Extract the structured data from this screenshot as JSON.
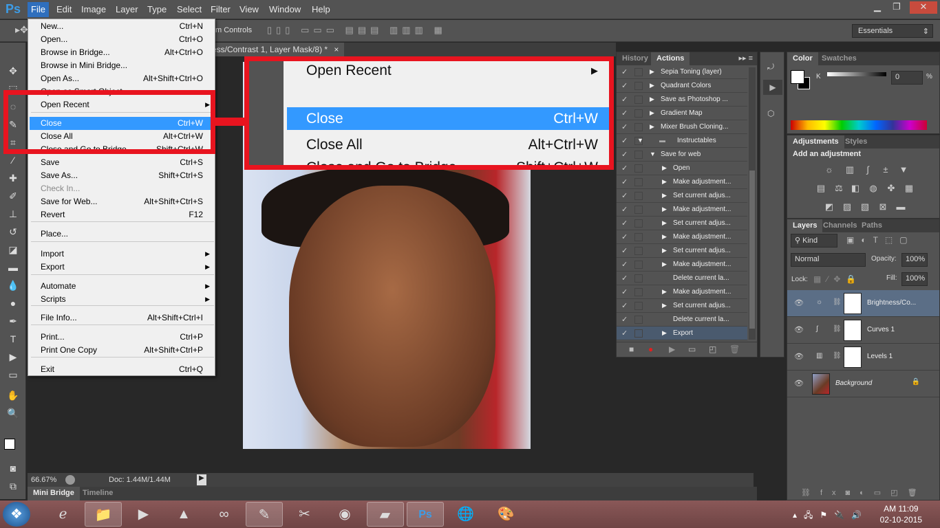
{
  "app": {
    "logo": "Ps"
  },
  "menubar": {
    "items": [
      "File",
      "Edit",
      "Image",
      "Layer",
      "Type",
      "Select",
      "Filter",
      "View",
      "Window",
      "Help"
    ]
  },
  "window_controls": {
    "minimize": "▁",
    "restore": "❐",
    "close": "✕"
  },
  "options": {
    "transform_controls_label": "m Controls",
    "workspace": "Essentials"
  },
  "document_tab": {
    "title": "ess/Contrast 1, Layer Mask/8) *",
    "close": "×"
  },
  "file_menu": {
    "items": [
      {
        "label": "New...",
        "shortcut": "Ctrl+N"
      },
      {
        "label": "Open...",
        "shortcut": "Ctrl+O"
      },
      {
        "label": "Browse in Bridge...",
        "shortcut": "Alt+Ctrl+O"
      },
      {
        "label": "Browse in Mini Bridge...",
        "shortcut": ""
      },
      {
        "label": "Open As...",
        "shortcut": "Alt+Shift+Ctrl+O"
      },
      {
        "label": "Open as Smart Object...",
        "shortcut": ""
      },
      {
        "label": "Open Recent",
        "shortcut": "",
        "submenu": true
      },
      {
        "label": "Close",
        "shortcut": "Ctrl+W",
        "highlighted": true
      },
      {
        "label": "Close All",
        "shortcut": "Alt+Ctrl+W"
      },
      {
        "label": "Close and Go to Bridge...",
        "shortcut": "Shift+Ctrl+W"
      },
      {
        "label": "Save",
        "shortcut": "Ctrl+S"
      },
      {
        "label": "Save As...",
        "shortcut": "Shift+Ctrl+S"
      },
      {
        "label": "Check In...",
        "shortcut": "",
        "disabled": true
      },
      {
        "label": "Save for Web...",
        "shortcut": "Alt+Shift+Ctrl+S"
      },
      {
        "label": "Revert",
        "shortcut": "F12"
      },
      {
        "label": "Place...",
        "shortcut": ""
      },
      {
        "label": "Import",
        "shortcut": "",
        "submenu": true
      },
      {
        "label": "Export",
        "shortcut": "",
        "submenu": true
      },
      {
        "label": "Automate",
        "shortcut": "",
        "submenu": true
      },
      {
        "label": "Scripts",
        "shortcut": "",
        "submenu": true
      },
      {
        "label": "File Info...",
        "shortcut": "Alt+Shift+Ctrl+I"
      },
      {
        "label": "Print...",
        "shortcut": "Ctrl+P"
      },
      {
        "label": "Print One Copy",
        "shortcut": "Alt+Shift+Ctrl+P"
      },
      {
        "label": "Exit",
        "shortcut": "Ctrl+Q"
      }
    ]
  },
  "callout": {
    "items": [
      {
        "label": "Open Recent",
        "shortcut": "▶"
      },
      {
        "label": "Close",
        "shortcut": "Ctrl+W",
        "highlighted": true
      },
      {
        "label": "Close All",
        "shortcut": "Alt+Ctrl+W"
      },
      {
        "label": "Close and Go to Bridge...",
        "shortcut": "Shift+Ctrl+W"
      }
    ]
  },
  "actions_panel": {
    "tabs": [
      "History",
      "Actions"
    ],
    "active_tab": "Actions",
    "rows": [
      {
        "label": "Sepia Toning (layer)",
        "level": 1,
        "expanded": false
      },
      {
        "label": "Quadrant Colors",
        "level": 1,
        "expanded": false
      },
      {
        "label": "Save as Photoshop ...",
        "level": 1,
        "expanded": false
      },
      {
        "label": "Gradient Map",
        "level": 1,
        "expanded": false
      },
      {
        "label": "Mixer Brush Cloning...",
        "level": 1,
        "expanded": false
      },
      {
        "label": "Instructables",
        "level": 0,
        "expanded": true,
        "folder": true
      },
      {
        "label": "Save for web",
        "level": 1,
        "expanded": true
      },
      {
        "label": "Open",
        "level": 2,
        "expanded": false
      },
      {
        "label": "Make adjustment...",
        "level": 2,
        "expanded": false
      },
      {
        "label": "Set current adjus...",
        "level": 2,
        "expanded": false
      },
      {
        "label": "Make adjustment...",
        "level": 2,
        "expanded": false
      },
      {
        "label": "Set current adjus...",
        "level": 2,
        "expanded": false
      },
      {
        "label": "Make adjustment...",
        "level": 2,
        "expanded": false
      },
      {
        "label": "Set current adjus...",
        "level": 2,
        "expanded": false
      },
      {
        "label": "Make adjustment...",
        "level": 2,
        "expanded": false
      },
      {
        "label": "Delete current la...",
        "level": 2,
        "noarrow": true
      },
      {
        "label": "Make adjustment...",
        "level": 2,
        "expanded": false
      },
      {
        "label": "Set current adjus...",
        "level": 2,
        "expanded": false
      },
      {
        "label": "Delete current la...",
        "level": 2,
        "noarrow": true
      },
      {
        "label": "Export",
        "level": 2,
        "expanded": false,
        "selected": true
      }
    ]
  },
  "color_panel": {
    "tabs": [
      "Color",
      "Swatches"
    ],
    "channel": "K",
    "value": "0",
    "unit": "%"
  },
  "adjustments_panel": {
    "tabs": [
      "Adjustments",
      "Styles"
    ],
    "heading": "Add an adjustment",
    "icons": [
      [
        "brightness-contrast",
        "levels",
        "curves",
        "exposure",
        "vibrance"
      ],
      [
        "hue-saturation",
        "color-balance",
        "black-white",
        "photo-filter",
        "channel-mixer",
        "color-lookup"
      ],
      [
        "invert",
        "posterize",
        "threshold",
        "selective-color",
        "gradient-map"
      ]
    ],
    "glyphs": [
      [
        "☼",
        "▥",
        "∫",
        "±",
        "▼"
      ],
      [
        "▤",
        "⚖",
        "◧",
        "◍",
        "✤",
        "▦"
      ],
      [
        "◩",
        "▨",
        "▧",
        "⊠",
        "▬"
      ]
    ]
  },
  "layers_panel": {
    "tabs": [
      "Layers",
      "Channels",
      "Paths"
    ],
    "filter": "Kind",
    "blend_mode": "Normal",
    "opacity_label": "Opacity:",
    "opacity": "100%",
    "lock_label": "Lock:",
    "fill_label": "Fill:",
    "fill": "100%",
    "layers": [
      {
        "name": "Brightness/Co...",
        "icon": "☼",
        "selected": true
      },
      {
        "name": "Curves 1",
        "icon": "∫"
      },
      {
        "name": "Levels 1",
        "icon": "▥"
      },
      {
        "name": "Background",
        "italic": true,
        "locked": true
      }
    ]
  },
  "status": {
    "zoom": "66.67%",
    "doc": "Doc: 1.44M/1.44M"
  },
  "bottom_tabs": [
    "Mini Bridge",
    "Timeline"
  ],
  "taskbar": {
    "apps": [
      "start",
      "internet-explorer",
      "file-explorer",
      "media-player",
      "vlc",
      "arduino",
      "notepad",
      "snipping-tool",
      "chrome",
      "sticky-notes",
      "photoshop",
      "network-app",
      "paint"
    ],
    "time": "AM 11:09",
    "date": "02-10-2015"
  },
  "colors": {
    "highlight": "#3399ff",
    "callout_red": "#e8141f",
    "ps_blue": "#3d9ce6"
  }
}
